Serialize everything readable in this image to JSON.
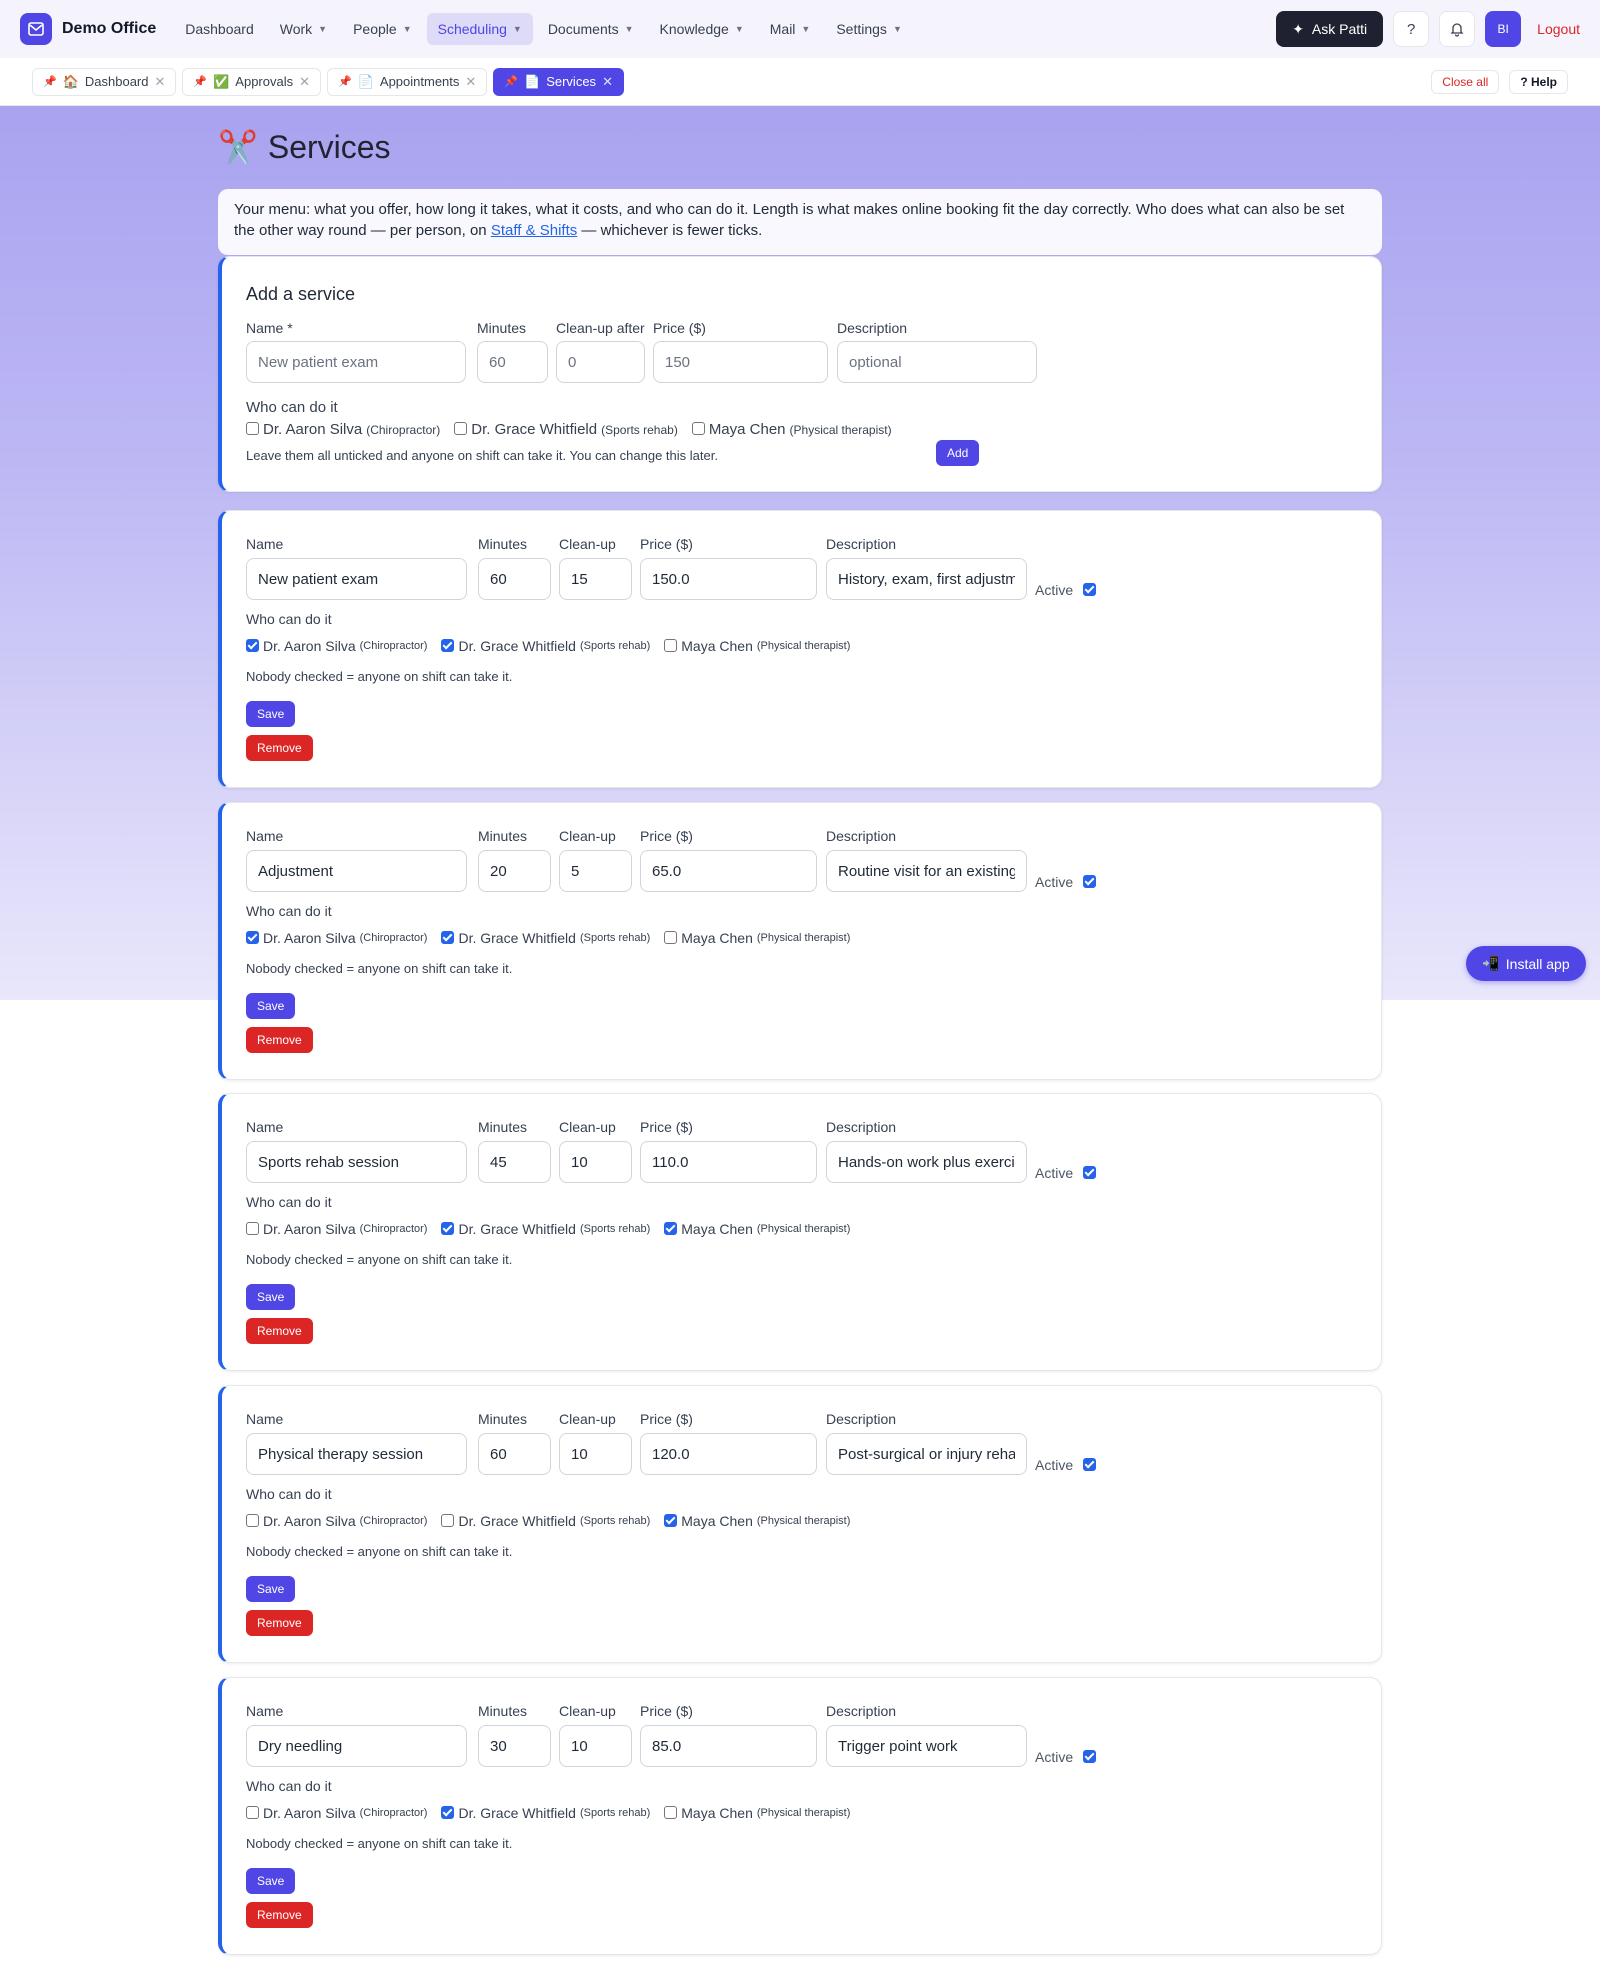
{
  "brand": {
    "name": "Demo Office"
  },
  "nav": {
    "items": [
      {
        "label": "Dashboard"
      },
      {
        "label": "Work"
      },
      {
        "label": "People"
      },
      {
        "label": "Scheduling"
      },
      {
        "label": "Documents"
      },
      {
        "label": "Knowledge"
      },
      {
        "label": "Mail"
      },
      {
        "label": "Settings"
      }
    ],
    "ask_label": "Ask Patti",
    "help_icon": "?",
    "avatar": "BI",
    "logout": "Logout"
  },
  "tabs": {
    "items": [
      {
        "emoji": "🏠",
        "label": "Dashboard"
      },
      {
        "emoji": "✅",
        "label": "Approvals"
      },
      {
        "emoji": "📄",
        "label": "Appointments"
      },
      {
        "emoji": "📄",
        "label": "Services"
      }
    ],
    "close_all": "Close all",
    "help": "? Help"
  },
  "page": {
    "title_emoji": "✂️",
    "title": "Services",
    "intro_before": "Your menu: what you offer, how long it takes, what it costs, and who can do it. Length is what makes online booking fit the day correctly. Who does what can also be set the other way round — per person, on ",
    "intro_link": "Staff & Shifts",
    "intro_after": " — whichever is fewer ticks."
  },
  "add_form": {
    "heading": "Add a service",
    "labels": {
      "name": "Name *",
      "minutes": "Minutes",
      "cleanup": "Clean-up after",
      "price": "Price ($)",
      "description": "Description"
    },
    "placeholders": {
      "name": "New patient exam",
      "minutes": "60",
      "cleanup": "0",
      "price": "150",
      "description": "optional"
    },
    "who_label": "Who can do it",
    "hint": "Leave them all unticked and anyone on shift can take it. You can change this later.",
    "add_button": "Add"
  },
  "staff": [
    {
      "name": "Dr. Aaron Silva",
      "role": "(Chiropractor)"
    },
    {
      "name": "Dr. Grace Whitfield",
      "role": "(Sports rehab)"
    },
    {
      "name": "Maya Chen",
      "role": "(Physical therapist)"
    }
  ],
  "service_labels": {
    "name": "Name",
    "minutes": "Minutes",
    "cleanup": "Clean-up",
    "price": "Price ($)",
    "description": "Description",
    "active": "Active",
    "who": "Who can do it",
    "nobody_note": "Nobody checked = anyone on shift can take it.",
    "save": "Save",
    "remove": "Remove"
  },
  "services": [
    {
      "name": "New patient exam",
      "minutes": "60",
      "cleanup": "15",
      "price": "150.0",
      "description": "History, exam, first adjustment",
      "active": true,
      "staff_checked": [
        true,
        true,
        false
      ]
    },
    {
      "name": "Adjustment",
      "minutes": "20",
      "cleanup": "5",
      "price": "65.0",
      "description": "Routine visit for an existing patient",
      "active": true,
      "staff_checked": [
        true,
        true,
        false
      ]
    },
    {
      "name": "Sports rehab session",
      "minutes": "45",
      "cleanup": "10",
      "price": "110.0",
      "description": "Hands-on work plus exercises",
      "active": true,
      "staff_checked": [
        false,
        true,
        true
      ]
    },
    {
      "name": "Physical therapy session",
      "minutes": "60",
      "cleanup": "10",
      "price": "120.0",
      "description": "Post-surgical or injury rehab",
      "active": true,
      "staff_checked": [
        false,
        false,
        true
      ]
    },
    {
      "name": "Dry needling",
      "minutes": "30",
      "cleanup": "10",
      "price": "85.0",
      "description": "Trigger point work",
      "active": true,
      "staff_checked": [
        false,
        true,
        false
      ]
    }
  ],
  "install_app": "Install app",
  "colors": {
    "accent": "#4f46e5",
    "danger": "#dc2626",
    "card_border": "#2563eb"
  }
}
